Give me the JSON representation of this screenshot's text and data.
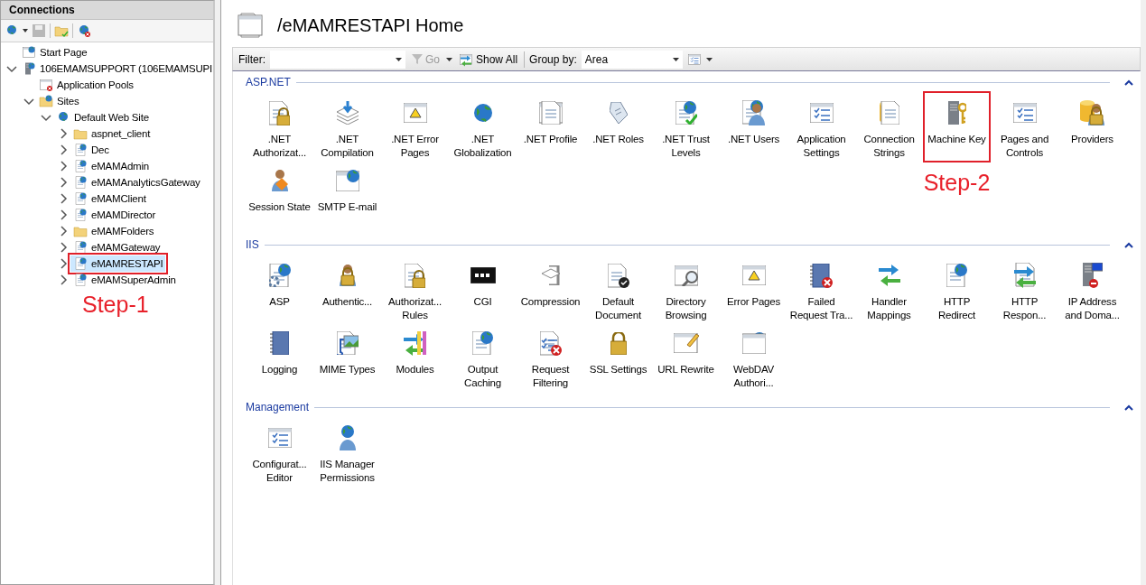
{
  "connections": {
    "title": "Connections",
    "tree": [
      {
        "label": "Start Page",
        "kind": "start-page",
        "selected": false
      },
      {
        "label": "106EMAMSUPPORT (106EMAMSUPI",
        "kind": "server",
        "expanded": true,
        "selected": false,
        "children": [
          {
            "label": "Application Pools",
            "kind": "app-pools",
            "selected": false
          },
          {
            "label": "Sites",
            "kind": "sites",
            "expanded": true,
            "selected": false,
            "children": [
              {
                "label": "Default Web Site",
                "kind": "site",
                "expanded": true,
                "selected": false,
                "children": [
                  {
                    "label": "aspnet_client",
                    "kind": "folder",
                    "expanded": false,
                    "selected": false
                  },
                  {
                    "label": "Dec",
                    "kind": "application",
                    "expanded": false,
                    "selected": false
                  },
                  {
                    "label": "eMAMAdmin",
                    "kind": "application",
                    "expanded": false,
                    "selected": false
                  },
                  {
                    "label": "eMAMAnalyticsGateway",
                    "kind": "application",
                    "expanded": false,
                    "selected": false
                  },
                  {
                    "label": "eMAMClient",
                    "kind": "application",
                    "expanded": false,
                    "selected": false
                  },
                  {
                    "label": "eMAMDirector",
                    "kind": "application",
                    "expanded": false,
                    "selected": false
                  },
                  {
                    "label": "eMAMFolders",
                    "kind": "folder",
                    "expanded": false,
                    "selected": false
                  },
                  {
                    "label": "eMAMGateway",
                    "kind": "application",
                    "expanded": false,
                    "selected": false
                  },
                  {
                    "label": "eMAMRESTAPI",
                    "kind": "application",
                    "expanded": false,
                    "selected": true,
                    "highlighted": true,
                    "note": "Step-1"
                  },
                  {
                    "label": "eMAMSuperAdmin",
                    "kind": "application",
                    "expanded": false,
                    "selected": false
                  }
                ]
              }
            ]
          }
        ]
      }
    ]
  },
  "home": {
    "title": "/eMAMRESTAPI Home",
    "filter_bar": {
      "filter_label": "Filter:",
      "go": {
        "label": "Go",
        "disabled": true
      },
      "show_all": "Show All",
      "group_by_label": "Group by:",
      "group_by_value": "Area"
    },
    "groups": [
      {
        "title": "ASP.NET",
        "expanded": true,
        "features": [
          {
            "label": ".NET Authorizat..."
          },
          {
            "label": ".NET Compilation"
          },
          {
            "label": ".NET Error Pages"
          },
          {
            "label": ".NET Globalization"
          },
          {
            "label": ".NET Profile"
          },
          {
            "label": ".NET Roles"
          },
          {
            "label": ".NET Trust Levels"
          },
          {
            "label": ".NET Users"
          },
          {
            "label": "Application Settings"
          },
          {
            "label": "Connection Strings"
          },
          {
            "label": "Machine Key",
            "highlighted": true,
            "note": "Step-2"
          },
          {
            "label": "Pages and Controls"
          },
          {
            "label": "Providers"
          },
          {
            "label": "Session State"
          },
          {
            "label": "SMTP E-mail"
          }
        ]
      },
      {
        "title": "IIS",
        "expanded": true,
        "features": [
          {
            "label": "ASP"
          },
          {
            "label": "Authentic..."
          },
          {
            "label": "Authorizat... Rules"
          },
          {
            "label": "CGI"
          },
          {
            "label": "Compression"
          },
          {
            "label": "Default Document"
          },
          {
            "label": "Directory Browsing"
          },
          {
            "label": "Error Pages"
          },
          {
            "label": "Failed Request Tra..."
          },
          {
            "label": "Handler Mappings"
          },
          {
            "label": "HTTP Redirect"
          },
          {
            "label": "HTTP Respon..."
          },
          {
            "label": "IP Address and Doma..."
          },
          {
            "label": "Logging"
          },
          {
            "label": "MIME Types"
          },
          {
            "label": "Modules"
          },
          {
            "label": "Output Caching"
          },
          {
            "label": "Request Filtering"
          },
          {
            "label": "SSL Settings"
          },
          {
            "label": "URL Rewrite"
          },
          {
            "label": "WebDAV Authori..."
          }
        ]
      },
      {
        "title": "Management",
        "expanded": true,
        "features": [
          {
            "label": "Configurat... Editor"
          },
          {
            "label": "IIS Manager Permissions"
          }
        ]
      }
    ]
  }
}
